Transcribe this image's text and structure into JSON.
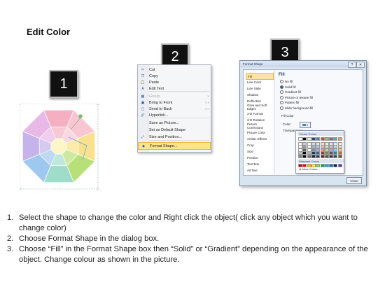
{
  "title": "Edit Color",
  "badges": [
    "1",
    "2",
    "3"
  ],
  "octagon_colors": {
    "outer": [
      "#f7c6d3",
      "#fbe08d",
      "#b8e07a",
      "#9fdcc9",
      "#9ec8ef",
      "#c5b3ea",
      "#e8b9e6",
      "#f4b0c0"
    ],
    "inner": [
      "#fbd7e0",
      "#fdeaa8",
      "#cfe9a3",
      "#bde8da",
      "#bdd9f4",
      "#d6c9f0",
      "#efcdec",
      "#f8c8d4"
    ],
    "center": "#fdf6c8"
  },
  "context_menu": {
    "items": [
      {
        "label": "Cut",
        "icon": "scissors-icon",
        "glyph": "✂",
        "arrow": "",
        "dim": false
      },
      {
        "label": "Copy",
        "icon": "copy-icon",
        "glyph": "❐",
        "arrow": "",
        "dim": false
      },
      {
        "label": "Paste",
        "icon": "paste-icon",
        "glyph": "📋",
        "arrow": "",
        "dim": false
      },
      {
        "label": "Edit Text",
        "icon": "text-icon",
        "glyph": "A",
        "arrow": "",
        "dim": false
      },
      {
        "label": "Group",
        "icon": "group-icon",
        "glyph": "▦",
        "arrow": "›",
        "dim": true
      },
      {
        "label": "Bring to Front",
        "icon": "bring-front-icon",
        "glyph": "▣",
        "arrow": "› ›",
        "dim": false
      },
      {
        "label": "Send to Back",
        "icon": "send-back-icon",
        "glyph": "▢",
        "arrow": "› ›",
        "dim": false
      },
      {
        "label": "Hyperlink...",
        "icon": "hyperlink-icon",
        "glyph": "🔗",
        "arrow": "",
        "dim": false
      },
      {
        "label": "Save as Picture...",
        "icon": "",
        "glyph": "",
        "arrow": "",
        "dim": false
      },
      {
        "label": "Set as Default Shape",
        "icon": "",
        "glyph": "",
        "arrow": "",
        "dim": false
      },
      {
        "label": "Size and Position...",
        "icon": "size-icon",
        "glyph": "⤢",
        "arrow": "",
        "dim": false
      },
      {
        "label": "Format Shape...",
        "icon": "format-shape-icon",
        "glyph": "◆",
        "arrow": "",
        "dim": false
      }
    ]
  },
  "dialog": {
    "title": "Format Shape",
    "nav": [
      "Fill",
      "Line Color",
      "Line Style",
      "Shadow",
      "Reflection",
      "Glow and Soft Edges",
      "3-D Format",
      "3-D Rotation",
      "Picture Corrections",
      "Picture Color",
      "Artistic Effects",
      "Crop",
      "Size",
      "Position",
      "Text Box",
      "Alt Text"
    ],
    "fill_heading": "Fill",
    "options": [
      "No fill",
      "Solid fill",
      "Gradient fill",
      "Picture or texture fill",
      "Pattern fill",
      "Slide background fill"
    ],
    "fill_color_label": "Fill Color",
    "color_label": "Color:",
    "transparency_label": "Transparency:",
    "theme_colors_label": "Theme Colors",
    "standard_colors_label": "Standard Colors",
    "more_colors": "More Colors...",
    "close": "Close",
    "theme_top": [
      "#ffffff",
      "#000000",
      "#eeece1",
      "#1f497d",
      "#4f81bd",
      "#c0504d",
      "#9bbb59",
      "#8064a2",
      "#4bacc6",
      "#f79646"
    ],
    "standard": [
      "#c00000",
      "#ff0000",
      "#ffc000",
      "#ffff00",
      "#92d050",
      "#00b050",
      "#00b0f0",
      "#0070c0",
      "#002060",
      "#7030a0"
    ]
  },
  "steps": [
    "Select the shape to change the color and Right click the object( click any object which you want to change color)",
    "Choose Format Shape in the dialog box.",
    "Choose “Fill” in the Format Shape box then “Solid” or “Gradient” depending on the appearance of the object. Change colour as shown in the picture."
  ]
}
